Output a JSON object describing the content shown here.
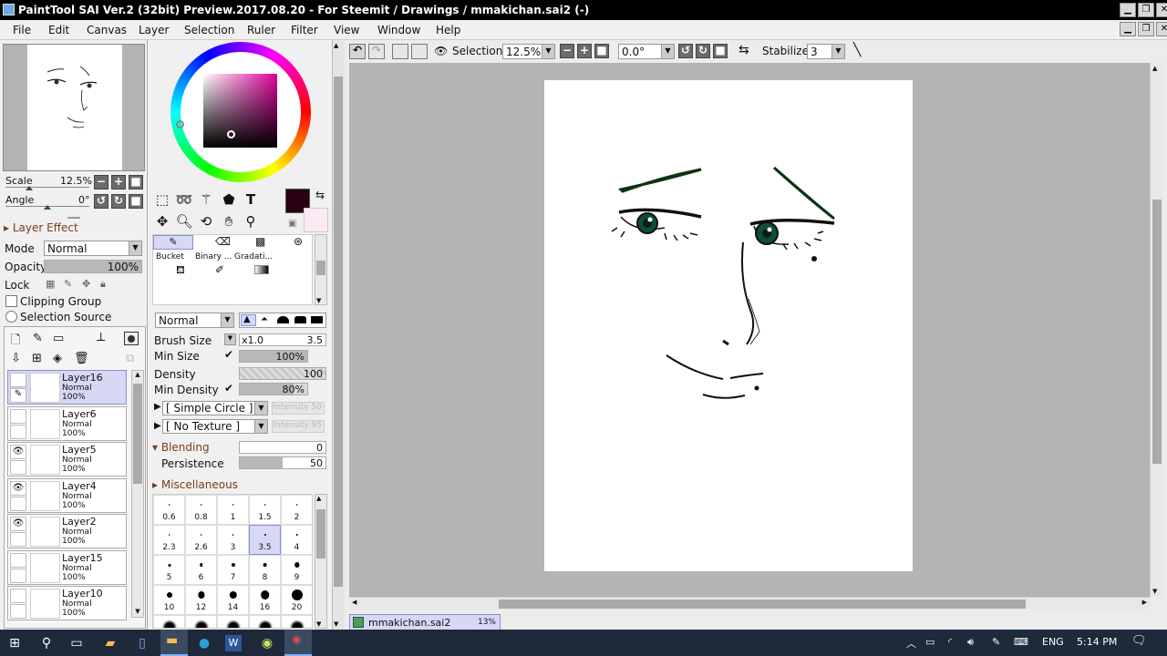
{
  "window": {
    "title": "PaintTool SAI Ver.2 (32bit) Preview.2017.08.20 - For Steemit / Drawings / mmakichan.sai2 (-)"
  },
  "menu": [
    "File",
    "Edit",
    "Canvas",
    "Layer",
    "Selection",
    "Ruler",
    "Filter",
    "View",
    "Window",
    "Help"
  ],
  "navigator": {
    "scale_label": "Scale",
    "scale_value": "12.5%",
    "angle_label": "Angle",
    "angle_value": "0°"
  },
  "layer_effect": {
    "header": "Layer Effect",
    "mode_label": "Mode",
    "mode_value": "Normal",
    "opacity_label": "Opacity",
    "opacity_value": "100%",
    "opacity_fraction": 1.0,
    "lock_label": "Lock",
    "clipping_label": "Clipping Group",
    "selection_source_label": "Selection Source"
  },
  "layers": [
    {
      "name": "Layer16",
      "mode": "Normal",
      "opacity": "100%",
      "visible": false,
      "selected": true
    },
    {
      "name": "Layer6",
      "mode": "Normal",
      "opacity": "100%",
      "visible": false,
      "selected": false
    },
    {
      "name": "Layer5",
      "mode": "Normal",
      "opacity": "100%",
      "visible": true,
      "selected": false
    },
    {
      "name": "Layer4",
      "mode": "Normal",
      "opacity": "100%",
      "visible": true,
      "selected": false
    },
    {
      "name": "Layer2",
      "mode": "Normal",
      "opacity": "100%",
      "visible": true,
      "selected": false
    },
    {
      "name": "Layer15",
      "mode": "Normal",
      "opacity": "100%",
      "visible": false,
      "selected": false
    },
    {
      "name": "Layer10",
      "mode": "Normal",
      "opacity": "100%",
      "visible": false,
      "selected": false
    }
  ],
  "colors": {
    "primary": "#2a0014",
    "secondary": "#fbe9f4",
    "accent_section": "#7b3b1a",
    "highlight": "#d6d8f5"
  },
  "tool_sets": {
    "bucket": "Bucket",
    "binary": "Binary ...",
    "gradation": "Gradati..."
  },
  "brush": {
    "blend_mode": "Normal",
    "size_label": "Brush Size",
    "size_multiplier": "x1.0",
    "size_value": "3.5",
    "min_size_label": "Min Size",
    "min_size_value": "100%",
    "min_size_fraction": 1.0,
    "density_label": "Density",
    "density_value": "100",
    "min_density_label": "Min Density",
    "min_density_value": "80%",
    "min_density_fraction": 0.8,
    "shape_value": "[ Simple Circle ]",
    "shape_intensity": "Intensity 50",
    "texture_value": "[ No Texture ]",
    "texture_intensity": "Intensity 95",
    "blending_header": "Blending",
    "blending_value": "0",
    "blending_fraction": 0.0,
    "persistence_label": "Persistence",
    "persistence_value": "50",
    "persistence_fraction": 0.5,
    "misc_header": "Miscellaneous"
  },
  "brush_sizes": [
    "0.6",
    "0.8",
    "1",
    "1.5",
    "2",
    "2.3",
    "2.6",
    "3",
    "3.5",
    "4",
    "5",
    "6",
    "7",
    "8",
    "9",
    "10",
    "12",
    "14",
    "16",
    "20"
  ],
  "selected_brush_size": "3.5",
  "toolbar": {
    "selection_label": "Selection",
    "zoom_value": "12.5%",
    "rotation_value": "0.0°",
    "stabilizer_label": "Stabilizer",
    "stabilizer_value": "3"
  },
  "document_tab": {
    "name": "mmakichan.sai2",
    "zoom": "13%"
  },
  "taskbar": {
    "language": "ENG",
    "time": "5:14 PM"
  }
}
